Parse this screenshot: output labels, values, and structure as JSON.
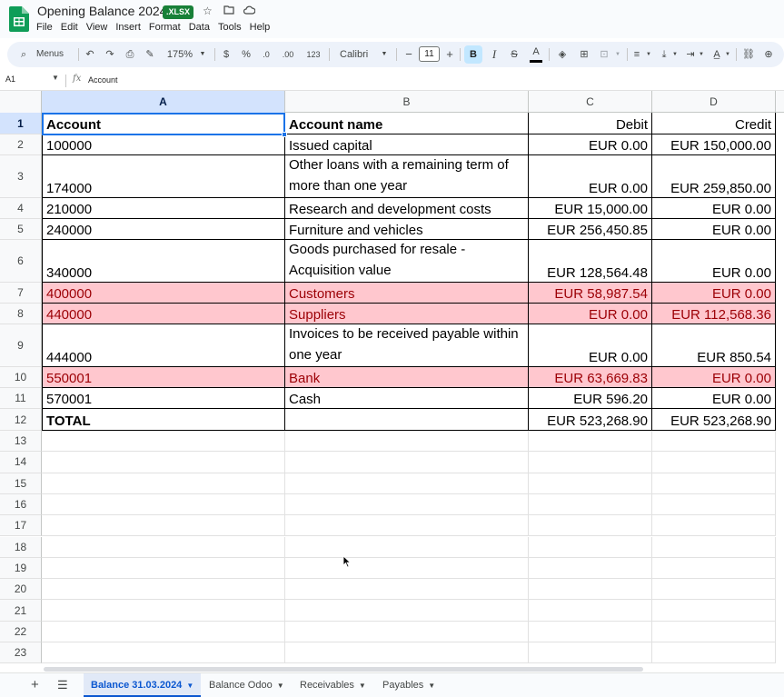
{
  "doc": {
    "title": "Opening Balance 2024",
    "badge": ".XLSX"
  },
  "menu": [
    "File",
    "Edit",
    "View",
    "Insert",
    "Format",
    "Data",
    "Tools",
    "Help"
  ],
  "toolbar": {
    "menus_label": "Menus",
    "zoom": "175%",
    "currency": "$",
    "percent": "%",
    "decrease_decimals": ".0",
    "increase_decimals": ".00",
    "number_format": "123",
    "font": "Calibri",
    "font_size": "11",
    "bold": "B",
    "italic": "I",
    "strikethrough": "S",
    "text_color": "A"
  },
  "formula_bar": {
    "cell_ref": "A1",
    "fx": "fx",
    "content": "Account"
  },
  "columns": [
    "A",
    "B",
    "C",
    "D"
  ],
  "rows": [
    {
      "num": "1",
      "a": "Account",
      "b": "Account name",
      "c": "Debit",
      "d": "Credit"
    },
    {
      "num": "2",
      "a": "100000",
      "b": "Issued capital",
      "c": "EUR 0.00",
      "d": "EUR 150,000.00"
    },
    {
      "num": "3",
      "a": "174000",
      "b": "Other loans with a remaining term of more than one year",
      "c": "EUR 0.00",
      "d": "EUR 259,850.00"
    },
    {
      "num": "4",
      "a": "210000",
      "b": "Research and development costs",
      "c": "EUR 15,000.00",
      "d": "EUR 0.00"
    },
    {
      "num": "5",
      "a": "240000",
      "b": "Furniture and vehicles",
      "c": "EUR 256,450.85",
      "d": "EUR 0.00"
    },
    {
      "num": "6",
      "a": "340000",
      "b": "Goods purchased for resale - Acquisition value",
      "c": "EUR 128,564.48",
      "d": "EUR 0.00"
    },
    {
      "num": "7",
      "a": "400000",
      "b": "Customers",
      "c": "EUR 58,987.54",
      "d": "EUR 0.00"
    },
    {
      "num": "8",
      "a": "440000",
      "b": "Suppliers",
      "c": "EUR 0.00",
      "d": "EUR 112,568.36"
    },
    {
      "num": "9",
      "a": "444000",
      "b": "Invoices to be received payable within one year",
      "c": "EUR 0.00",
      "d": "EUR 850.54"
    },
    {
      "num": "10",
      "a": "550001",
      "b": "Bank",
      "c": "EUR 63,669.83",
      "d": "EUR 0.00"
    },
    {
      "num": "11",
      "a": "570001",
      "b": "Cash",
      "c": "EUR 596.20",
      "d": "EUR 0.00"
    },
    {
      "num": "12",
      "a": "TOTAL",
      "b": "",
      "c": "EUR 523,268.90",
      "d": "EUR 523,268.90"
    }
  ],
  "empty_rows": [
    "13",
    "14",
    "15",
    "16",
    "17",
    "18",
    "19",
    "20",
    "21",
    "22",
    "23"
  ],
  "sheets": [
    "Balance 31.03.2024",
    "Balance Odoo",
    "Receivables",
    "Payables"
  ],
  "colors": {
    "highlight_fill": "#ffc7ce",
    "highlight_text": "#9c0006",
    "selection": "#1a73e8",
    "xlsx_badge": "#188038"
  }
}
